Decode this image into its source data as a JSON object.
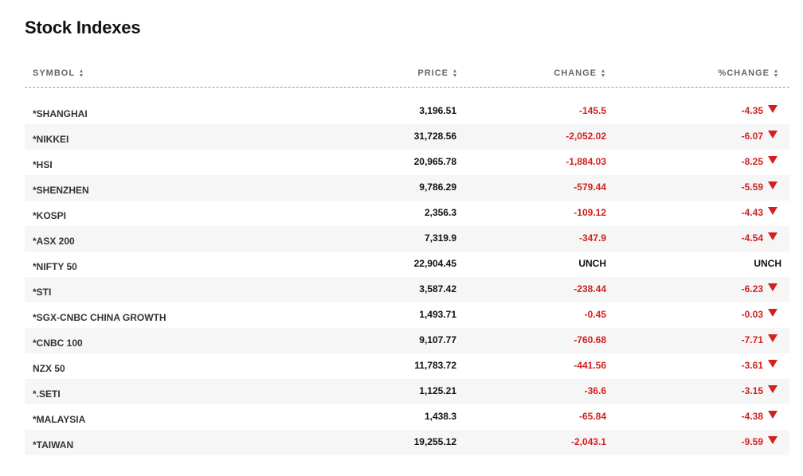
{
  "title": "Stock Indexes",
  "headers": {
    "symbol": "SYMBOL",
    "price": "PRICE",
    "change": "CHANGE",
    "pct_change": "%CHANGE"
  },
  "colors": {
    "negative": "#d12121",
    "neutral": "#111111",
    "row_stripe": "#f6f6f6"
  },
  "icons": {
    "sort": "sort-arrows-icon",
    "down": "down-triangle-icon"
  },
  "rows": [
    {
      "symbol": "*SHANGHAI",
      "price": "3,196.51",
      "change": "-145.5",
      "pct": "-4.35",
      "dir": "down"
    },
    {
      "symbol": "*NIKKEI",
      "price": "31,728.56",
      "change": "-2,052.02",
      "pct": "-6.07",
      "dir": "down"
    },
    {
      "symbol": "*HSI",
      "price": "20,965.78",
      "change": "-1,884.03",
      "pct": "-8.25",
      "dir": "down"
    },
    {
      "symbol": "*SHENZHEN",
      "price": "9,786.29",
      "change": "-579.44",
      "pct": "-5.59",
      "dir": "down"
    },
    {
      "symbol": "*KOSPI",
      "price": "2,356.3",
      "change": "-109.12",
      "pct": "-4.43",
      "dir": "down"
    },
    {
      "symbol": "*ASX 200",
      "price": "7,319.9",
      "change": "-347.9",
      "pct": "-4.54",
      "dir": "down"
    },
    {
      "symbol": "*NIFTY 50",
      "price": "22,904.45",
      "change": "UNCH",
      "pct": "UNCH",
      "dir": "unch"
    },
    {
      "symbol": "*STI",
      "price": "3,587.42",
      "change": "-238.44",
      "pct": "-6.23",
      "dir": "down"
    },
    {
      "symbol": "*SGX-CNBC CHINA GROWTH",
      "price": "1,493.71",
      "change": "-0.45",
      "pct": "-0.03",
      "dir": "down"
    },
    {
      "symbol": "*CNBC 100",
      "price": "9,107.77",
      "change": "-760.68",
      "pct": "-7.71",
      "dir": "down"
    },
    {
      "symbol": "NZX 50",
      "price": "11,783.72",
      "change": "-441.56",
      "pct": "-3.61",
      "dir": "down"
    },
    {
      "symbol": "*.SETI",
      "price": "1,125.21",
      "change": "-36.6",
      "pct": "-3.15",
      "dir": "down"
    },
    {
      "symbol": "*MALAYSIA",
      "price": "1,438.3",
      "change": "-65.84",
      "pct": "-4.38",
      "dir": "down"
    },
    {
      "symbol": "*TAIWAN",
      "price": "19,255.12",
      "change": "-2,043.1",
      "pct": "-9.59",
      "dir": "down"
    }
  ]
}
